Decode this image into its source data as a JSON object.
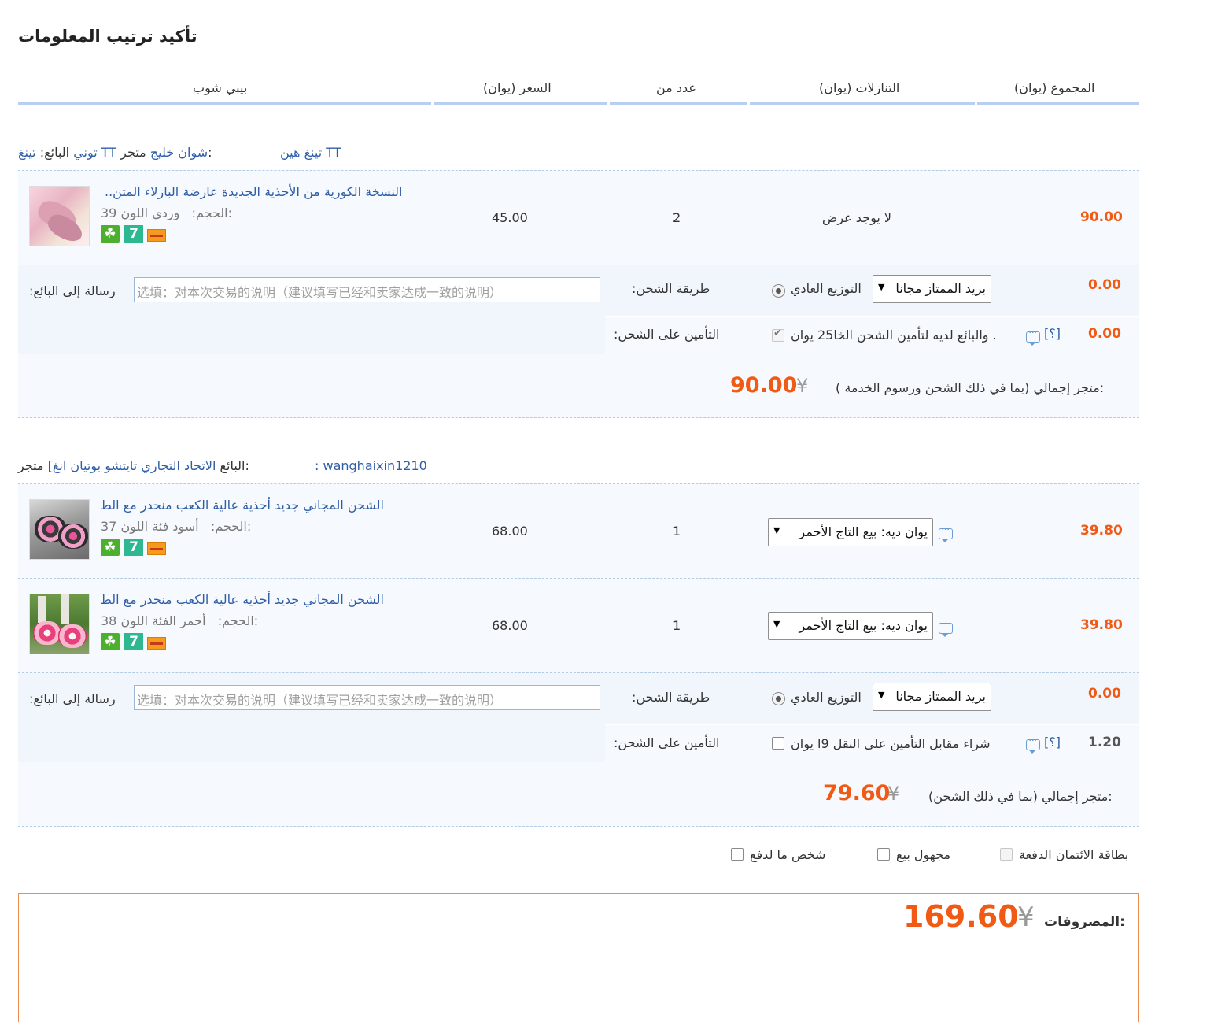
{
  "page_title": "تأكيد ترتيب المعلومات",
  "columns": {
    "store": "بيبي شوب",
    "price": "(السعر (يوان",
    "quantity": "عدد من",
    "discount": "(التنازلات (يوان",
    "total": "(المجموع (يوان"
  },
  "currency_symbol": "¥",
  "stores": [
    {
      "store_label": "متجر:",
      "store_name": "تينغ TT شوان خليج",
      "seller_label": "البائع:",
      "seller_name": "توني",
      "extra_link": "تينغ هين TT",
      "items": [
        {
          "title": "..النسخة الكورية من الأحذية الجديدة عارضة البازلاء المتن",
          "attr_label_1": "اللون:",
          "attr_value_1": "وردي",
          "attr_label_2": "الحجم:",
          "attr_value_2": "39",
          "price": "45.00",
          "qty": "2",
          "discount": "لا يوجد عرض",
          "total": "90.00"
        }
      ],
      "message_label": ":رسالة إلى البائع",
      "message_placeholder": "选填：对本次交易的说明（建议填写已经和卖家达成一致的说明）",
      "shipping_label": ":طريقة الشحن",
      "shipping_option": "التوزيع العادي",
      "shipping_select": "بريد الممتاز مجانا",
      "shipping_cost": "0.00",
      "insurance_label": ":التأمين على الشحن",
      "insurance_text": "والبائع لديه لتأمين الشحن الخا25 يوان .",
      "insurance_help": "[؟]",
      "insurance_cost": "0.00",
      "insurance_checked": true,
      "subtotal_label": "متجر إجمالي (بما في ذلك الشحن ورسوم الخدمة ):",
      "subtotal": "90.00"
    },
    {
      "store_label": "متجر:",
      "store_name": "الاتحاد التجاري تايتشو بوتيان انغ]",
      "seller_label": "البائع",
      "seller_name": "wanghaixin1210 :",
      "items": [
        {
          "title": "الشحن المجاني جديد أحذية عالية الكعب منحدر مع الط",
          "attr_label_1": "فئة اللون:",
          "attr_value_1": "أسود",
          "attr_label_2": "الحجم:",
          "attr_value_2": "37",
          "price": "68.00",
          "qty": "1",
          "promo_select": "يوان ديه: بيع التاج الأحمر",
          "total": "39.80"
        },
        {
          "title": "الشحن المجاني جديد أحذية عالية الكعب منحدر مع الط",
          "attr_label_1": "الفئة اللون:",
          "attr_value_1": "أحمر",
          "attr_label_2": "الحجم:",
          "attr_value_2": "38",
          "price": "68.00",
          "qty": "1",
          "promo_select": "يوان ديه: بيع التاج الأحمر",
          "total": "39.80"
        }
      ],
      "message_label": ":رسالة إلى البائع",
      "message_placeholder": "选填：对本次交易的说明（建议填写已经和卖家达成一致的说明）",
      "shipping_label": ":طريقة الشحن",
      "shipping_option": "التوزيع العادي",
      "shipping_select": "بريد الممتاز مجانا",
      "shipping_cost": "0.00",
      "insurance_label": ":التأمين على الشحن",
      "insurance_text": "شراء مقابل التأمين على النقل 9ا يوان",
      "insurance_help": "[؟]",
      "insurance_cost": "1.20",
      "insurance_checked": false,
      "subtotal_label": "متجر إجمالي (بما في ذلك الشحن):",
      "subtotal": "79.60"
    }
  ],
  "options": {
    "credit_card": "بطاقة الائتمان الدفعة",
    "anonymous": "مجهول بيع",
    "pay_for_other": "شخص ما لدفع"
  },
  "grand_total": {
    "label": "المصروفات:",
    "value": "169.60"
  },
  "colors": {
    "accent_orange": "#f05a14",
    "link_blue": "#2f5ea8",
    "header_line": "#b8cff0"
  }
}
